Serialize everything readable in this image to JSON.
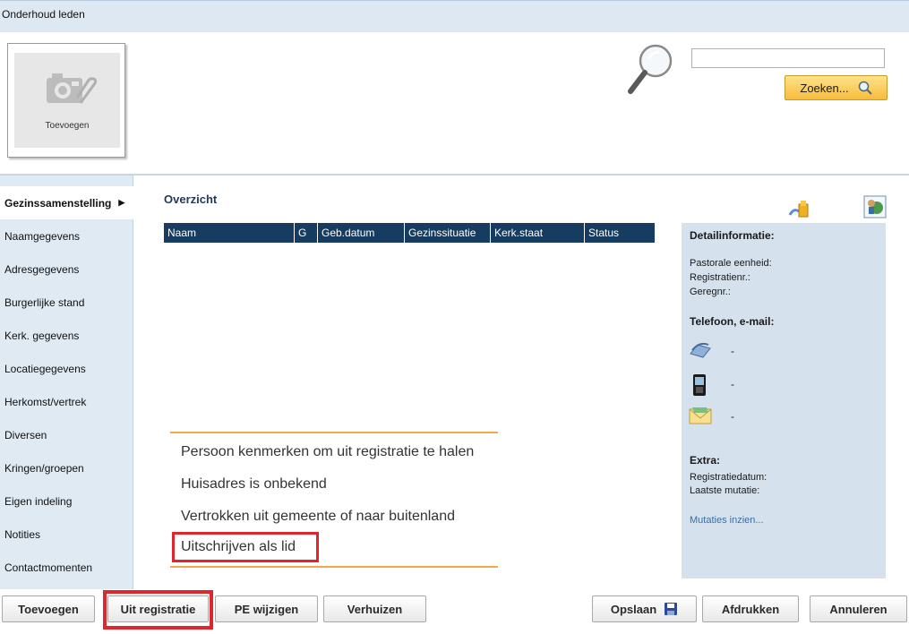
{
  "window": {
    "title": "Onderhoud leden"
  },
  "photo": {
    "label": "Toevoegen"
  },
  "search": {
    "value": "",
    "button_label": "Zoeken..."
  },
  "sidebar": {
    "items": [
      {
        "label": "Gezinssamenstelling"
      },
      {
        "label": "Naamgegevens"
      },
      {
        "label": "Adresgegevens"
      },
      {
        "label": "Burgerlijke stand"
      },
      {
        "label": "Kerk. gegevens"
      },
      {
        "label": "Locatiegegevens"
      },
      {
        "label": "Herkomst/vertrek"
      },
      {
        "label": "Diversen"
      },
      {
        "label": "Kringen/groepen"
      },
      {
        "label": "Eigen indeling"
      },
      {
        "label": "Notities"
      },
      {
        "label": "Contactmomenten"
      }
    ],
    "active_index": 0
  },
  "overview": {
    "title": "Overzicht",
    "columns": [
      "Naam",
      "G",
      "Geb.datum",
      "Gezinssituatie",
      "Kerk.staat",
      "Status"
    ],
    "rows": []
  },
  "detail": {
    "title": "Detailinformatie:",
    "pastorale": "Pastorale eenheid:",
    "registratienr": "Registratienr.:",
    "geregnr": "Geregnr.:",
    "contact_title": "Telefoon, e-mail:",
    "phone": "-",
    "mobile": "-",
    "email": "-",
    "extra_title": "Extra:",
    "registratiedatum": "Registratiedatum:",
    "laatste_mutatie": "Laatste mutatie:",
    "mutaties_link": "Mutaties inzien..."
  },
  "popup_menu": {
    "items": [
      "Persoon kenmerken om uit registratie te halen",
      "Huisadres is onbekend",
      "Vertrokken uit gemeente of naar buitenland",
      "Uitschrijven als lid"
    ],
    "highlighted_index": 3
  },
  "footer": {
    "add_label": "Toevoegen",
    "uit_registratie_label": "Uit registratie",
    "pe_wijzigen_label": "PE wijzigen",
    "verhuizen_label": "Verhuizen",
    "opslaan_label": "Opslaan",
    "afdrukken_label": "Afdrukken",
    "annuleren_label": "Annuleren"
  },
  "colors": {
    "table_header": "#173c61",
    "sidebar_bg": "#dfeaf3",
    "detail_bg": "#d5e1ec",
    "accent_orange": "#f3a84a",
    "highlight_red": "#e0262c",
    "search_button": "#f6bd3a"
  }
}
